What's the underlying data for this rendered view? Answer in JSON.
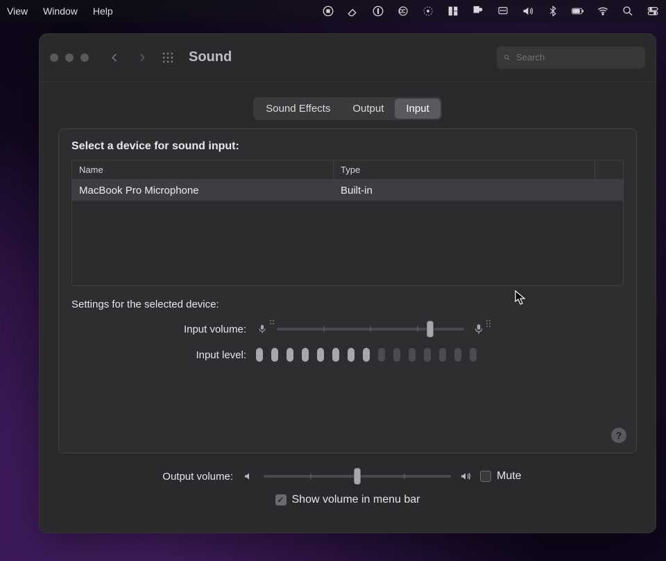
{
  "menubar": {
    "left": [
      "View",
      "Window",
      "Help"
    ],
    "right_icons": [
      "record-icon",
      "eraser-icon",
      "info-icon",
      "cc-icon",
      "target-icon",
      "panels-icon",
      "flag-icon",
      "remote-icon",
      "sound-icon",
      "bluetooth-icon",
      "battery-icon",
      "wifi-icon",
      "spotlight-icon",
      "control-center-icon"
    ]
  },
  "window": {
    "title": "Sound",
    "search_placeholder": "Search"
  },
  "tabs": [
    {
      "label": "Sound Effects",
      "active": false
    },
    {
      "label": "Output",
      "active": false
    },
    {
      "label": "Input",
      "active": true
    }
  ],
  "panel": {
    "select_heading": "Select a device for sound input:",
    "columns": [
      "Name",
      "Type"
    ],
    "rows": [
      {
        "name": "MacBook Pro Microphone",
        "type": "Built-in",
        "selected": true
      }
    ],
    "settings_heading": "Settings for the selected device:",
    "input_volume_label": "Input volume:",
    "input_level_label": "Input level:",
    "input_volume_percent": 70,
    "level_on_count": 8,
    "level_total": 15,
    "help_label": "?"
  },
  "bottom": {
    "output_volume_label": "Output volume:",
    "output_volume_percent": 50,
    "mute_label": "Mute",
    "mute_checked": false,
    "show_volume_label": "Show volume in menu bar",
    "show_volume_checked": true
  }
}
